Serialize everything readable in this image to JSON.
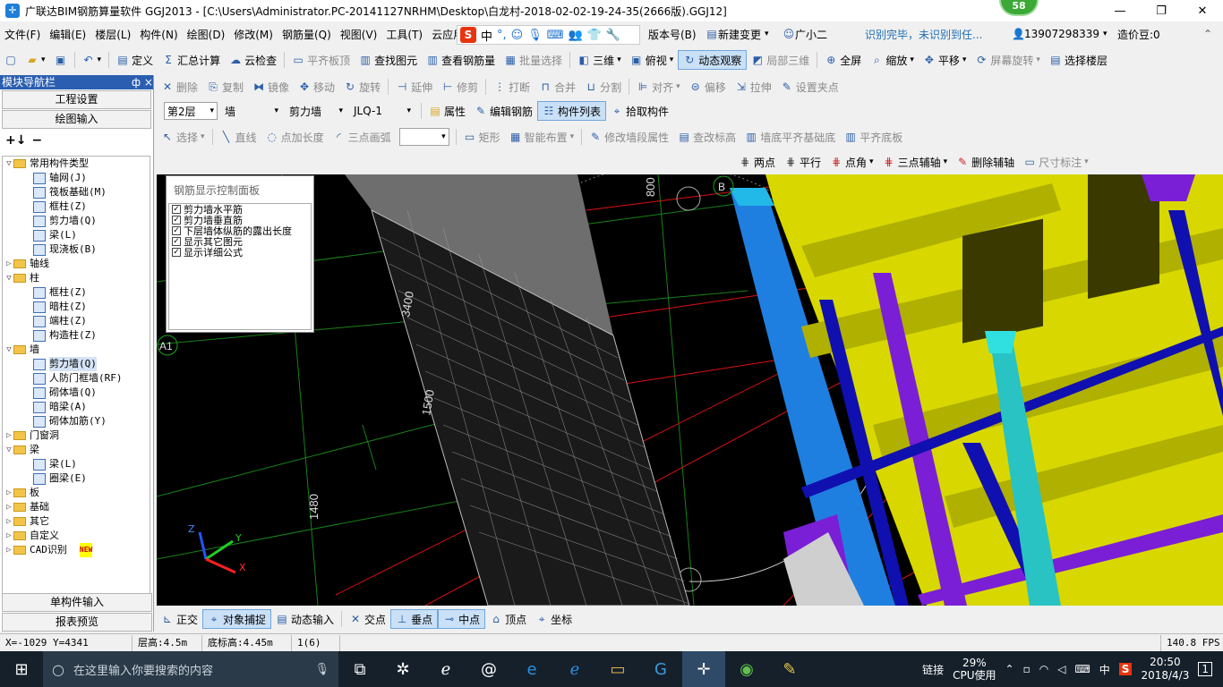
{
  "title": "广联达BIM钢筋算量软件 GGJ2013 - [C:\\Users\\Administrator.PC-20141127NRHM\\Desktop\\白龙村-2018-02-02-19-24-35(2666版).GGJ12]",
  "badge": "58",
  "menu": [
    "文件(F)",
    "编辑(E)",
    "楼层(L)",
    "构件(N)",
    "绘图(D)",
    "修改(M)",
    "钢筋量(Q)",
    "视图(V)",
    "工具(T)",
    "云应用"
  ],
  "ime": {
    "label": "中"
  },
  "menu_right": {
    "version": "版本号(B)",
    "change": "新建变更",
    "assistant": "广小二",
    "notice": "识别完毕，未识别到任...",
    "phone": "13907298339",
    "price": "造价豆:0"
  },
  "toolbar1": [
    "定义",
    "汇总计算",
    "云检查",
    "平齐板顶",
    "查找图元",
    "查看钢筋量",
    "批量选择",
    "三维",
    "俯视",
    "动态观察",
    "局部三维",
    "全屏",
    "缩放",
    "平移",
    "屏幕旋转",
    "选择楼层"
  ],
  "toolbar2": [
    "删除",
    "复制",
    "镜像",
    "移动",
    "旋转",
    "延伸",
    "修剪",
    "打断",
    "合并",
    "分割",
    "对齐",
    "偏移",
    "拉伸",
    "设置夹点"
  ],
  "toolbar3": {
    "floor": "第2层",
    "type": "墙",
    "subtype": "剪力墙",
    "name": "JLQ-1",
    "buttons": [
      "属性",
      "编辑钢筋",
      "构件列表",
      "拾取构件"
    ]
  },
  "toolbar4": [
    "选择",
    "直线",
    "点加长度",
    "三点画弧",
    "矩形",
    "智能布置",
    "修改墙段属性",
    "查改标高",
    "墙底平齐基础底",
    "平齐底板"
  ],
  "toolbar5": [
    "两点",
    "平行",
    "点角",
    "三点辅轴",
    "删除辅轴",
    "尺寸标注"
  ],
  "nav": {
    "header": "模块导航栏",
    "pin": "ф ×",
    "top_buttons": [
      "工程设置",
      "绘图输入"
    ],
    "bottom_buttons": [
      "单构件输入",
      "报表预览"
    ],
    "tree": [
      {
        "lvl": 0,
        "tw": "▽",
        "k": "fold",
        "t": "常用构件类型"
      },
      {
        "lvl": 1,
        "k": "c",
        "t": "轴网(J)"
      },
      {
        "lvl": 1,
        "k": "c",
        "t": "筏板基础(M)"
      },
      {
        "lvl": 1,
        "k": "c",
        "t": "框柱(Z)"
      },
      {
        "lvl": 1,
        "k": "c",
        "t": "剪力墙(Q)"
      },
      {
        "lvl": 1,
        "k": "c",
        "t": "梁(L)"
      },
      {
        "lvl": 1,
        "k": "c",
        "t": "现浇板(B)"
      },
      {
        "lvl": 0,
        "tw": "▷",
        "k": "fold",
        "t": "轴线"
      },
      {
        "lvl": 0,
        "tw": "▽",
        "k": "fold",
        "t": "柱"
      },
      {
        "lvl": 1,
        "k": "c",
        "t": "框柱(Z)"
      },
      {
        "lvl": 1,
        "k": "c",
        "t": "暗柱(Z)"
      },
      {
        "lvl": 1,
        "k": "c",
        "t": "端柱(Z)"
      },
      {
        "lvl": 1,
        "k": "c",
        "t": "构造柱(Z)"
      },
      {
        "lvl": 0,
        "tw": "▽",
        "k": "fold",
        "t": "墙"
      },
      {
        "lvl": 1,
        "k": "c",
        "t": "剪力墙(Q)",
        "sel": true
      },
      {
        "lvl": 1,
        "k": "c",
        "t": "人防门框墙(RF)"
      },
      {
        "lvl": 1,
        "k": "c",
        "t": "砌体墙(Q)"
      },
      {
        "lvl": 1,
        "k": "c",
        "t": "暗梁(A)"
      },
      {
        "lvl": 1,
        "k": "c",
        "t": "砌体加筋(Y)"
      },
      {
        "lvl": 0,
        "tw": "▷",
        "k": "fold",
        "t": "门窗洞"
      },
      {
        "lvl": 0,
        "tw": "▽",
        "k": "fold",
        "t": "梁"
      },
      {
        "lvl": 1,
        "k": "c",
        "t": "梁(L)"
      },
      {
        "lvl": 1,
        "k": "c",
        "t": "圈梁(E)"
      },
      {
        "lvl": 0,
        "tw": "▷",
        "k": "fold",
        "t": "板"
      },
      {
        "lvl": 0,
        "tw": "▷",
        "k": "fold",
        "t": "基础"
      },
      {
        "lvl": 0,
        "tw": "▷",
        "k": "fold",
        "t": "其它"
      },
      {
        "lvl": 0,
        "tw": "▷",
        "k": "fold",
        "t": "自定义"
      },
      {
        "lvl": 0,
        "tw": "▷",
        "k": "fold",
        "t": "CAD识别",
        "new": "NEW"
      }
    ]
  },
  "panel": {
    "title": "钢筋显示控制面板",
    "items": [
      "剪力墙水平筋",
      "剪力墙垂直筋",
      "下层墙体纵筋的露出长度",
      "显示其它图元",
      "显示详细公式"
    ]
  },
  "viewport_labels": {
    "dim1": "800",
    "dim2": "3400",
    "dim3": "1500",
    "dim4": "1480",
    "axis_b": "B",
    "axis_a1": "A1"
  },
  "snapbar": [
    "正交",
    "对象捕捉",
    "动态输入",
    "交点",
    "垂点",
    "中点",
    "顶点",
    "坐标"
  ],
  "status": {
    "coords": "X=-1029 Y=4341",
    "floor_h": "层高:4.5m",
    "bottom_h": "底标高:4.45m",
    "count": "1(6)",
    "fps": "140.8 FPS"
  },
  "taskbar": {
    "search": "在这里输入你要搜索的内容",
    "link": "链接",
    "cpu": "29%",
    "cpu_label": "CPU使用",
    "ime": "中",
    "time": "20:50",
    "date": "2018/4/3",
    "notif": "1"
  }
}
